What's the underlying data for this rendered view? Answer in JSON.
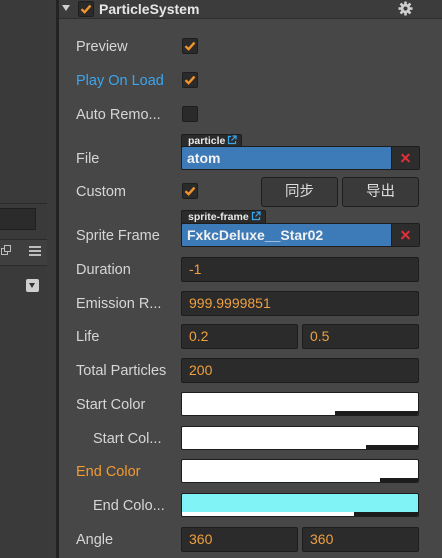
{
  "component": {
    "title": "ParticleSystem",
    "enabled": true
  },
  "colors": {
    "accent_check": "#f2932b",
    "label_blue": "#3aa6f0",
    "label_orange": "#f29a2e",
    "value_orange": "#f0a040",
    "asset_blue": "#3d7ab8",
    "clear_red": "#e0313a",
    "end_color_var": "#7ff3f6"
  },
  "properties": {
    "preview": {
      "label": "Preview",
      "checked": true
    },
    "play_on_load": {
      "label": "Play On Load",
      "checked": true
    },
    "auto_remove": {
      "label": "Auto Remo...",
      "checked": false
    },
    "file": {
      "label": "File",
      "tag": "particle",
      "value": "atom"
    },
    "custom": {
      "label": "Custom",
      "checked": true,
      "sync_button": "同步",
      "export_button": "导出"
    },
    "sprite_frame": {
      "label": "Sprite Frame",
      "tag": "sprite-frame",
      "value": "FxkcDeluxe__Star02"
    },
    "duration": {
      "label": "Duration",
      "value": "-1"
    },
    "emission_rate": {
      "label": "Emission R...",
      "value": "999.9999851"
    },
    "life": {
      "label": "Life",
      "value": "0.2",
      "var": "0.5"
    },
    "total_particles": {
      "label": "Total Particles",
      "value": "200"
    },
    "start_color": {
      "label": "Start Color",
      "color": "#ffffff",
      "alpha": 0.65
    },
    "start_color_var": {
      "label": "Start Col...",
      "color": "#ffffff",
      "alpha": 0.78
    },
    "end_color": {
      "label": "End Color",
      "color": "#ffffff",
      "alpha": 0.84
    },
    "end_color_var": {
      "label": "End Colo...",
      "color": "#7ff3f6",
      "alpha": 0.73
    },
    "angle": {
      "label": "Angle",
      "value": "360",
      "var": "360"
    }
  }
}
